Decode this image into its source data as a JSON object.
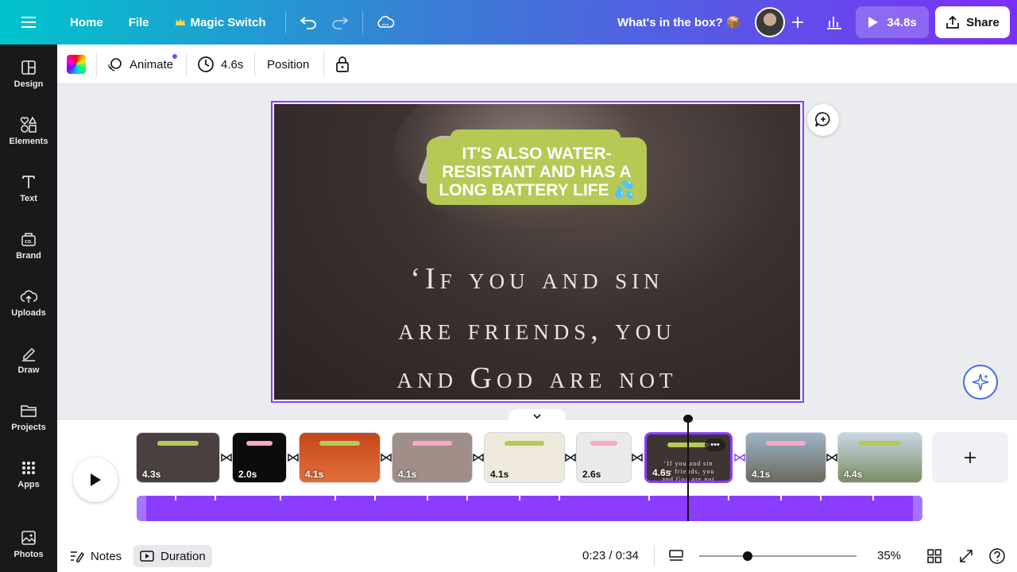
{
  "topbar": {
    "home": "Home",
    "file": "File",
    "magic_switch": "Magic Switch",
    "doc_title": "What's in the box? 📦",
    "play_duration": "34.8s",
    "share": "Share"
  },
  "sidebar": {
    "items": [
      {
        "label": "Design"
      },
      {
        "label": "Elements"
      },
      {
        "label": "Text"
      },
      {
        "label": "Brand"
      },
      {
        "label": "Uploads"
      },
      {
        "label": "Draw"
      },
      {
        "label": "Projects"
      },
      {
        "label": "Apps"
      },
      {
        "label": "Photos"
      }
    ]
  },
  "toolbar": {
    "animate": "Animate",
    "duration": "4.6s",
    "position": "Position"
  },
  "canvas": {
    "caption_line1": "IT'S ALSO WATER-",
    "caption_line2": "RESISTANT AND HAS A",
    "caption_line3": "LONG BATTERY LIFE 💦",
    "quote_line1": "‘If you and sin",
    "quote_line2": "are friends, you",
    "quote_line3": "and God are not"
  },
  "timeline": {
    "clips": [
      {
        "duration": "4.3s",
        "color": "#4a4040"
      },
      {
        "duration": "2.0s",
        "color": "#0c0c0c"
      },
      {
        "duration": "4.1s",
        "color": "#c4461c"
      },
      {
        "duration": "4.1s",
        "color": "#a08f88"
      },
      {
        "duration": "4.1s",
        "color": "#efe9dd"
      },
      {
        "duration": "2.6s",
        "color": "#ece9ea"
      },
      {
        "duration": "4.6s",
        "color": "#3e3432"
      },
      {
        "duration": "4.1s",
        "color": "#6e8fa6"
      },
      {
        "duration": "4.4s",
        "color": "#8a9a72"
      }
    ]
  },
  "bottombar": {
    "notes": "Notes",
    "duration": "Duration",
    "time": "0:23 / 0:34",
    "zoom": "35%"
  },
  "colors": {
    "accent": "#8b3dff",
    "caption_bg": "#b6c954",
    "sidebar_bg": "#18191b"
  }
}
